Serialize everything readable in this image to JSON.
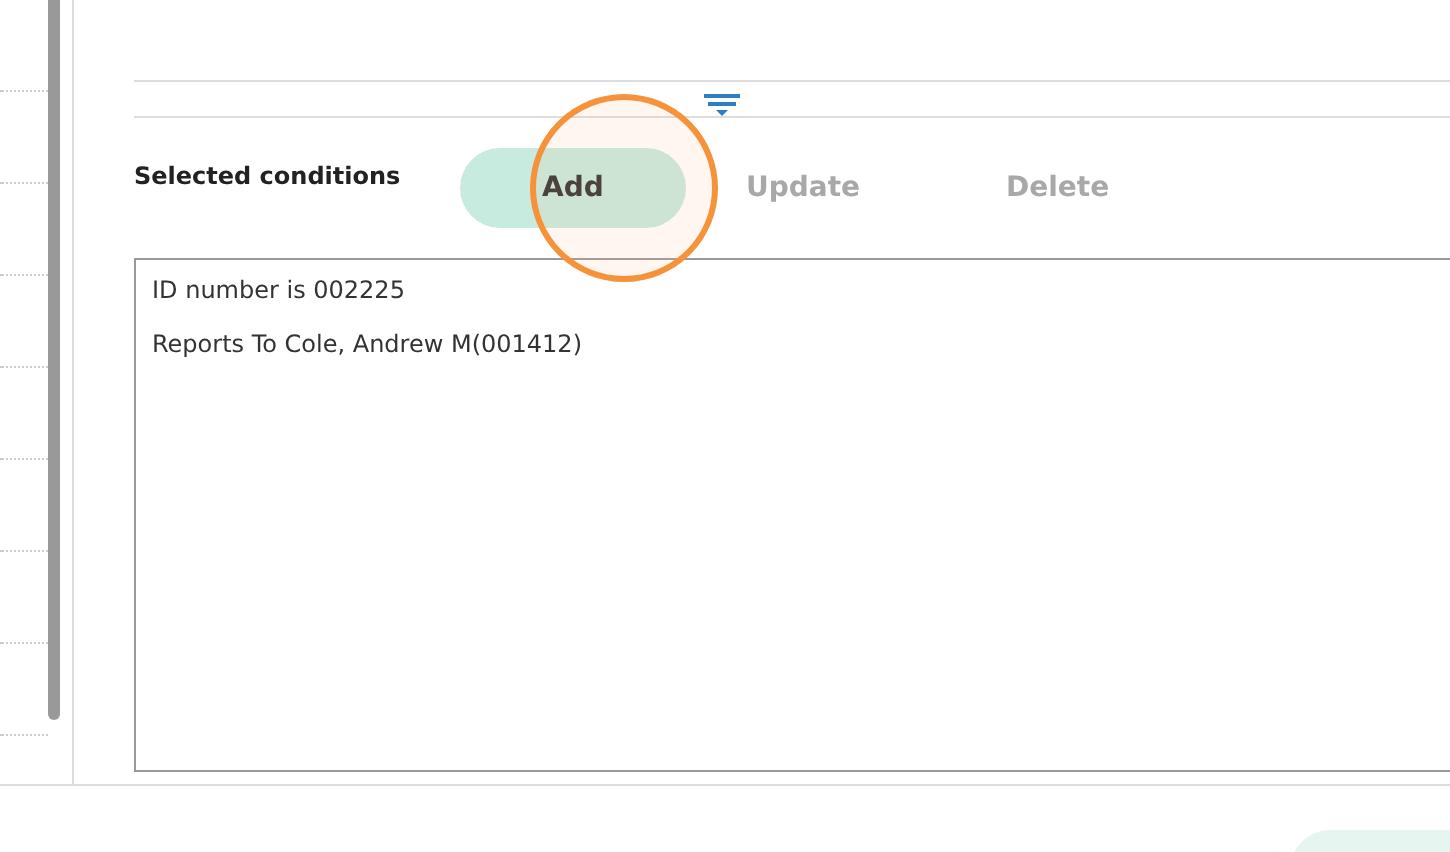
{
  "section_label": "Selected conditions",
  "actions": [
    {
      "label": "Add",
      "disabled": false,
      "highlighted": true
    },
    {
      "label": "Update",
      "disabled": true,
      "highlighted": false
    },
    {
      "label": "Delete",
      "disabled": true,
      "highlighted": false
    }
  ],
  "conditions": [
    {
      "text": "ID number is 002225"
    },
    {
      "text": "Reports To Cole, Andrew M(001412)"
    }
  ]
}
